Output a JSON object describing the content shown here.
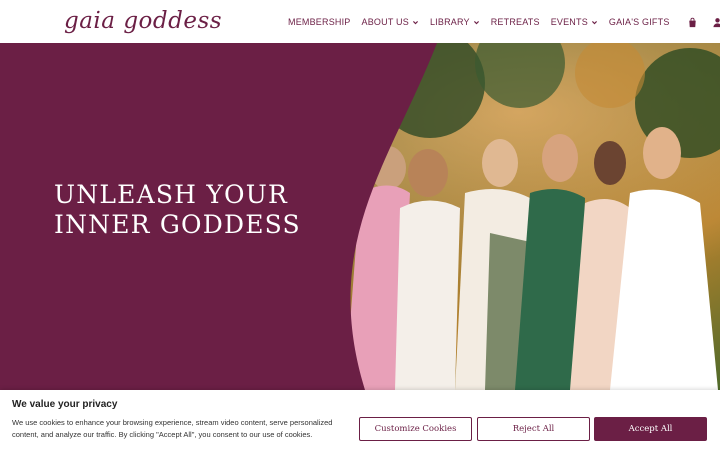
{
  "header": {
    "logo_text": "gaia goddess",
    "nav": [
      {
        "label": "MEMBERSHIP",
        "dropdown": false
      },
      {
        "label": "ABOUT US",
        "dropdown": true
      },
      {
        "label": "LIBRARY",
        "dropdown": true
      },
      {
        "label": "RETREATS",
        "dropdown": false
      },
      {
        "label": "EVENTS",
        "dropdown": true
      },
      {
        "label": "GAIA'S GIFTS",
        "dropdown": false
      }
    ],
    "icons": [
      "shopping-bag-icon",
      "account-icon"
    ]
  },
  "hero": {
    "title_line1": "UNLEASH YOUR",
    "title_line2": "INNER GODDESS",
    "image_description_icon": "photo-of-women"
  },
  "cookie_banner": {
    "title": "We value your privacy",
    "text": "We use cookies to enhance your browsing experience, stream video content, serve personalized content, and analyze our traffic. By clicking \"Accept All\", you consent to our use of cookies.",
    "customize_label": "Customize Cookies",
    "reject_label": "Reject All",
    "accept_label": "Accept All"
  },
  "colors": {
    "brand": "#6b1f45",
    "white": "#ffffff"
  }
}
